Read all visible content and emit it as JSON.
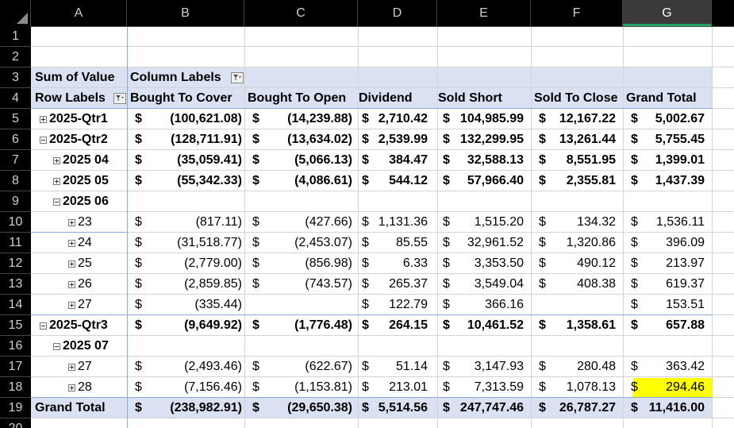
{
  "columns": [
    "A",
    "B",
    "C",
    "D",
    "E",
    "F",
    "G"
  ],
  "selected_column": "G",
  "row_numbers": [
    "1",
    "2",
    "3",
    "4",
    "5",
    "6",
    "7",
    "8",
    "9",
    "10",
    "11",
    "12",
    "13",
    "14",
    "15",
    "16",
    "17",
    "18",
    "19",
    "20"
  ],
  "pivot": {
    "corner_label": "Sum of Value",
    "column_labels": "Column Labels",
    "row_labels": "Row Labels",
    "headers": [
      "Bought To Cover",
      "Bought To Open",
      "Dividend",
      "Sold Short",
      "Sold To Close",
      "Grand Total"
    ],
    "currency_symbol": "$",
    "rows": [
      {
        "label": "2025-Qtr1",
        "expander": "plus",
        "indent": 0,
        "bold": true,
        "values": [
          "(100,621.08)",
          "(14,239.88)",
          "2,710.42",
          "104,985.99",
          "12,167.22",
          "5,002.67"
        ]
      },
      {
        "label": "2025-Qtr2",
        "expander": "minus",
        "indent": 0,
        "bold": true,
        "values": [
          "(128,711.91)",
          "(13,634.02)",
          "2,539.99",
          "132,299.95",
          "13,261.44",
          "5,755.45"
        ]
      },
      {
        "label": "2025 04",
        "expander": "plus",
        "indent": 1,
        "bold": true,
        "values": [
          "(35,059.41)",
          "(5,066.13)",
          "384.47",
          "32,588.13",
          "8,551.95",
          "1,399.01"
        ]
      },
      {
        "label": "2025 05",
        "expander": "plus",
        "indent": 1,
        "bold": true,
        "values": [
          "(55,342.33)",
          "(4,086.61)",
          "544.12",
          "57,966.40",
          "2,355.81",
          "1,437.39"
        ]
      },
      {
        "label": "2025 06",
        "expander": "minus",
        "indent": 1,
        "bold": true,
        "values": [
          "",
          "",
          "",
          "",
          "",
          ""
        ]
      },
      {
        "label": "23",
        "expander": "plus",
        "indent": 2,
        "bold": false,
        "values": [
          "(817.11)",
          "(427.66)",
          "1,131.36",
          "1,515.20",
          "134.32",
          "1,536.11"
        ]
      },
      {
        "label": "24",
        "expander": "plus",
        "indent": 2,
        "bold": false,
        "values": [
          "(31,518.77)",
          "(2,453.07)",
          "85.55",
          "32,961.52",
          "1,320.86",
          "396.09"
        ]
      },
      {
        "label": "25",
        "expander": "plus",
        "indent": 2,
        "bold": false,
        "values": [
          "(2,779.00)",
          "(856.98)",
          "6.33",
          "3,353.50",
          "490.12",
          "213.97"
        ]
      },
      {
        "label": "26",
        "expander": "plus",
        "indent": 2,
        "bold": false,
        "values": [
          "(2,859.85)",
          "(743.57)",
          "265.37",
          "3,549.04",
          "408.38",
          "619.37"
        ]
      },
      {
        "label": "27",
        "expander": "plus",
        "indent": 2,
        "bold": false,
        "values": [
          "(335.44)",
          "",
          "122.79",
          "366.16",
          "",
          "153.51"
        ]
      },
      {
        "label": "2025-Qtr3",
        "expander": "minus",
        "indent": 0,
        "bold": true,
        "values": [
          "(9,649.92)",
          "(1,776.48)",
          "264.15",
          "10,461.52",
          "1,358.61",
          "657.88"
        ]
      },
      {
        "label": "2025 07",
        "expander": "minus",
        "indent": 1,
        "bold": true,
        "values": [
          "",
          "",
          "",
          "",
          "",
          ""
        ]
      },
      {
        "label": "27",
        "expander": "plus",
        "indent": 2,
        "bold": false,
        "values": [
          "(2,493.46)",
          "(622.67)",
          "51.14",
          "3,147.93",
          "280.48",
          "363.42"
        ]
      },
      {
        "label": "28",
        "expander": "plus",
        "indent": 2,
        "bold": false,
        "values": [
          "(7,156.46)",
          "(1,153.81)",
          "213.01",
          "7,313.59",
          "1,078.13",
          "294.46"
        ]
      }
    ],
    "grand_total": {
      "label": "Grand Total",
      "values": [
        "(238,982.91)",
        "(29,650.38)",
        "5,514.56",
        "247,747.46",
        "26,787.27",
        "11,416.00"
      ]
    }
  },
  "highlight_color": "#ffff00",
  "pivot_header_color": "#d9e1f2",
  "selected_header_underline_color": "#21a366"
}
